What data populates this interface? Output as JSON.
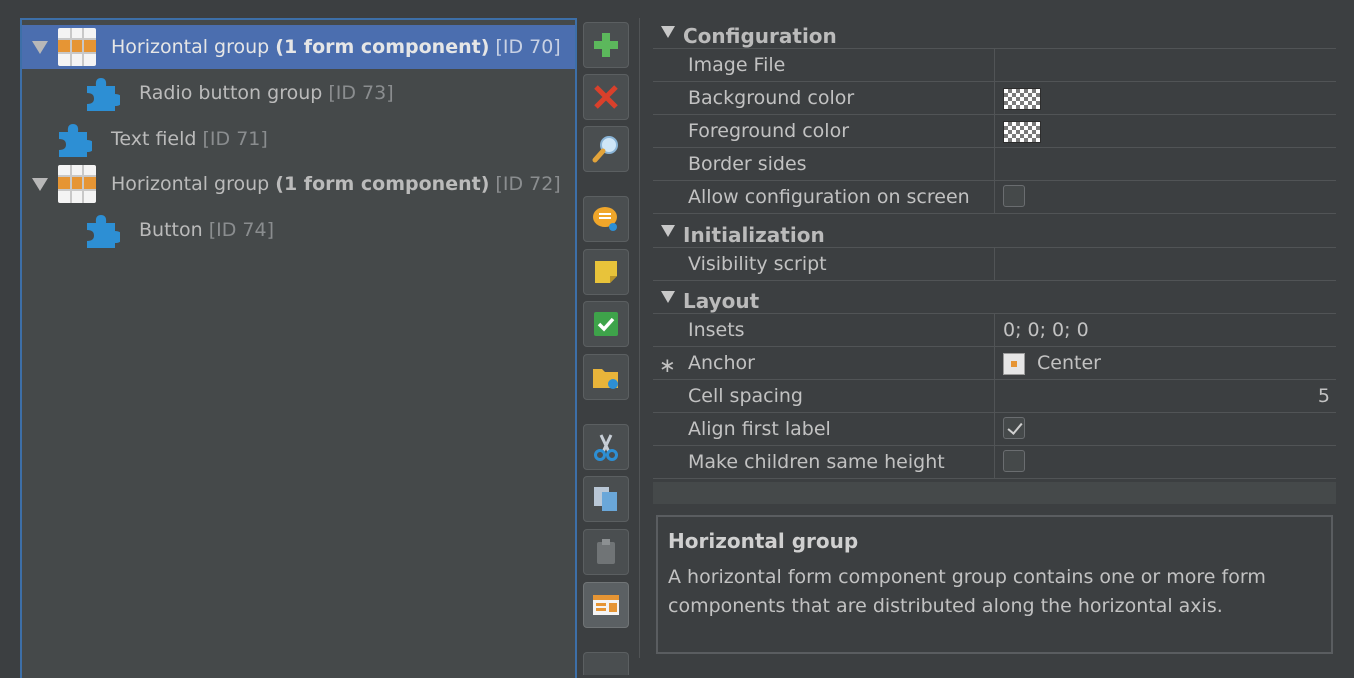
{
  "tree": {
    "nodes": [
      {
        "name": "Horizontal group",
        "count": "(1 form component)",
        "id": "[ID 70]"
      },
      {
        "name": "Radio button group",
        "id": "[ID 73]"
      },
      {
        "name": "Text field",
        "id": "[ID 71]"
      },
      {
        "name": "Horizontal group",
        "count": "(1 form component)",
        "id": "[ID 72]"
      },
      {
        "name": "Button",
        "id": "[ID 74]"
      }
    ]
  },
  "toolbar": {
    "buttons": [
      "add",
      "delete",
      "search",
      "comment",
      "note",
      "validate",
      "open-folder",
      "cut",
      "copy",
      "paste",
      "group"
    ]
  },
  "properties": {
    "sections": [
      {
        "title": "Configuration"
      },
      {
        "title": "Initialization"
      },
      {
        "title": "Layout"
      }
    ],
    "rows": {
      "image_file": {
        "name": "Image File",
        "value": ""
      },
      "background_color": {
        "name": "Background color"
      },
      "foreground_color": {
        "name": "Foreground color"
      },
      "border_sides": {
        "name": "Border sides",
        "value": ""
      },
      "allow_config": {
        "name": "Allow configuration on screen",
        "checked": false
      },
      "visibility_script": {
        "name": "Visibility script",
        "value": ""
      },
      "insets": {
        "name": "Insets",
        "value": "0; 0; 0; 0"
      },
      "anchor": {
        "name": "Anchor",
        "value": "Center",
        "marker": "∗"
      },
      "cell_spacing": {
        "name": "Cell spacing",
        "value": "5"
      },
      "align_first_label": {
        "name": "Align first label",
        "checked": true
      },
      "children_same_height": {
        "name": "Make children same height",
        "checked": false
      }
    }
  },
  "description": {
    "title": "Horizontal group",
    "text": "A horizontal form component group contains one or more form components that are distributed along the horizontal axis."
  },
  "colors": {
    "selection": "#4b6eaf",
    "orange": "#e69534",
    "puzzle": "#2d8fd4",
    "panel": "#45494a",
    "background": "#3c3f41"
  }
}
